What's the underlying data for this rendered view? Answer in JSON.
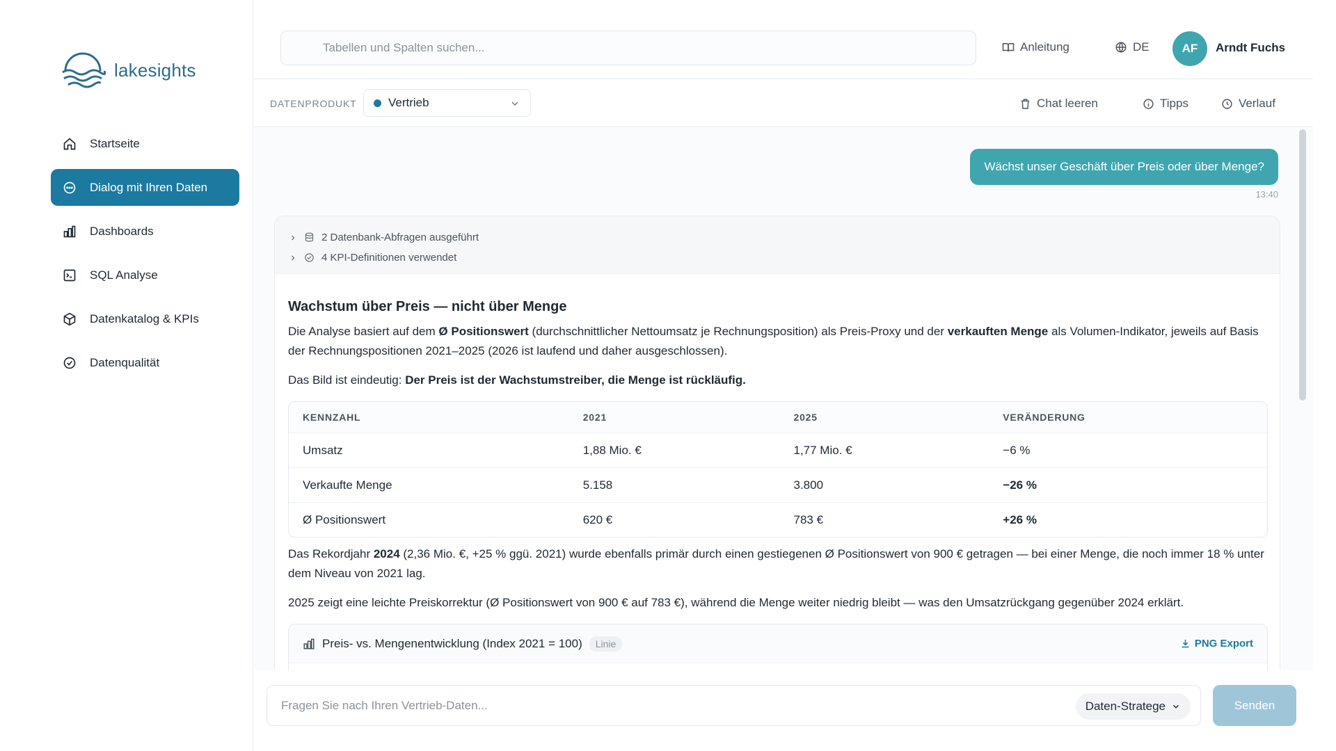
{
  "brand": {
    "name": "lakesights",
    "color": "#2b6d8c"
  },
  "colors": {
    "accent": "#1c7aa0",
    "bubble": "#3fa6b0",
    "send_disabled": "#9fc5d8"
  },
  "sidebar": {
    "items": [
      {
        "label": "Startseite",
        "icon": "home-icon"
      },
      {
        "label": "Dialog mit Ihren Daten",
        "icon": "chat-icon",
        "active": true
      },
      {
        "label": "Dashboards",
        "icon": "bar-chart-icon"
      },
      {
        "label": "SQL Analyse",
        "icon": "terminal-icon"
      },
      {
        "label": "Datenkatalog & KPIs",
        "icon": "package-icon"
      },
      {
        "label": "Datenqualität",
        "icon": "check-circle-icon"
      }
    ]
  },
  "header": {
    "search_placeholder": "Tabellen und Spalten suchen...",
    "guide_label": "Anleitung",
    "language": "DE",
    "user_initials": "AF",
    "user_name": "Arndt Fuchs"
  },
  "subheader": {
    "data_product_label": "DATENPRODUKT",
    "data_product_value": "Vertrieb",
    "clear_label": "Chat leeren",
    "tips_label": "Tipps",
    "history_label": "Verlauf"
  },
  "chat": {
    "user_message": "Wächst unser Geschäft über Preis oder über Menge?",
    "user_time": "13:40",
    "steps": [
      "2 Datenbank-Abfragen ausgeführt",
      "4 KPI-Definitionen verwendet"
    ],
    "answer": {
      "title": "Wachstum über Preis — nicht über Menge",
      "p1_a": "Die Analyse basiert auf dem ",
      "p1_b": "Ø Positionswert",
      "p1_c": " (durchschnittlicher Nettoumsatz je Rechnungsposition) als Preis-Proxy und der ",
      "p1_d": "verkauften Menge",
      "p1_e": " als Volumen-Indikator, jeweils auf Basis der Rechnungspositionen 2021–2025 (2026 ist laufend und daher ausgeschlossen).",
      "p2_a": "Das Bild ist eindeutig: ",
      "p2_b": "Der Preis ist der Wachstumstreiber, die Menge ist rückläufig.",
      "table": {
        "headers": [
          "KENNZAHL",
          "2021",
          "2025",
          "VERÄNDERUNG"
        ],
        "rows": [
          [
            "Umsatz",
            "1,88 Mio. €",
            "1,77 Mio. €",
            "−6 %"
          ],
          [
            "Verkaufte Menge",
            "5.158",
            "3.800",
            "−26 %"
          ],
          [
            "Ø Positionswert",
            "620 €",
            "783 €",
            "+26 %"
          ]
        ]
      },
      "p3_a": "Das Rekordjahr ",
      "p3_b": "2024",
      "p3_c": " (2,36 Mio. €, +25 % ggü. 2021) wurde ebenfalls primär durch einen gestiegenen Ø Positionswert von 900 € getragen — bei einer Menge, die noch immer 18 % unter dem Niveau von 2021 lag.",
      "p4": "2025 zeigt eine leichte Preiskorrektur (Ø Positionswert von 900 € auf 783 €), während die Menge weiter niedrig bleibt — was den Umsatzrückgang gegenüber 2024 erklärt.",
      "chart_title": "Preis- vs. Mengenentwicklung (Index 2021 = 100)",
      "chart_badge": "Linie",
      "export_label": "PNG Export"
    }
  },
  "composer": {
    "placeholder": "Fragen Sie nach Ihren Vertrieb-Daten...",
    "persona": "Daten-Stratege",
    "send_label": "Senden"
  }
}
